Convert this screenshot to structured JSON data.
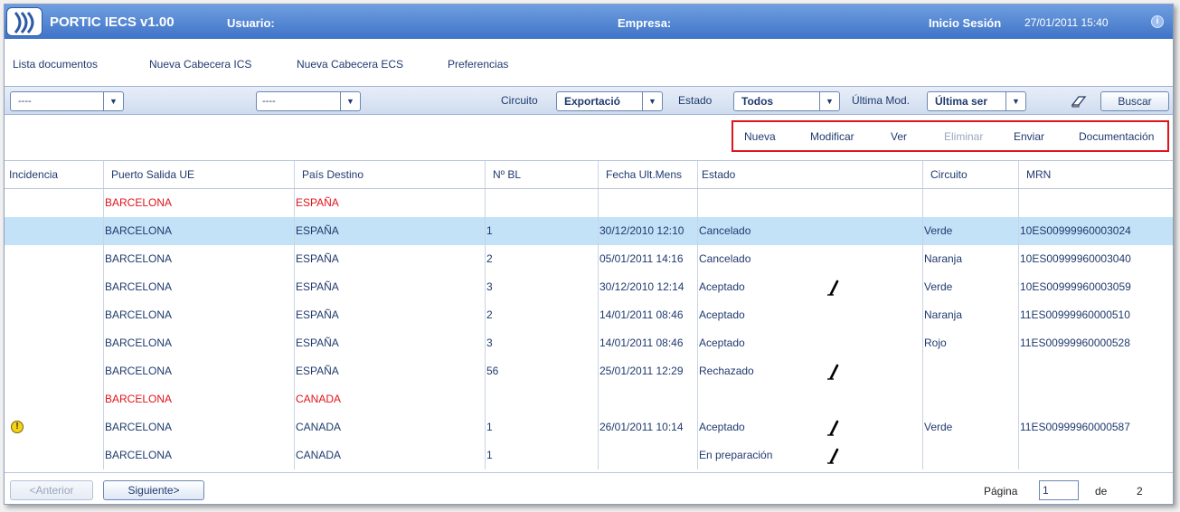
{
  "header": {
    "app_title": "PORTIC IECS v1.00",
    "usuario_label": "Usuario:",
    "empresa_label": "Empresa:",
    "inicio_label": "Inicio Sesión",
    "datetime": "27/01/2011 15:40",
    "info_glyph": "i"
  },
  "menu": {
    "items": [
      {
        "label": "Lista documentos"
      },
      {
        "label": "Nueva Cabecera ICS"
      },
      {
        "label": "Nueva Cabecera ECS"
      },
      {
        "label": "Preferencias"
      }
    ]
  },
  "filters": {
    "combo1_value": "----",
    "combo2_value": "----",
    "circuito_label": "Circuito",
    "circuito_value": "Exportació",
    "estado_label": "Estado",
    "estado_value": "Todos",
    "ultima_mod_label": "Última Mod.",
    "ultima_mod_value": "Última ser",
    "arrow_glyph": "▼",
    "buscar_label": "Buscar"
  },
  "actions": {
    "nueva": "Nueva",
    "modificar": "Modificar",
    "ver": "Ver",
    "eliminar": "Eliminar",
    "enviar": "Enviar",
    "documentacion": "Documentación"
  },
  "table": {
    "columns": [
      "Incidencia",
      "Puerto Salida UE",
      "País Destino",
      "Nº BL",
      "Fecha Ult.Mens",
      "Estado",
      "Circuito",
      "MRN"
    ],
    "rows": [
      {
        "incidencia": "",
        "puerto": "BARCELONA",
        "pais": "ESPAÑA",
        "bl": "",
        "fecha": "",
        "estado": "",
        "circuito": "",
        "mrn": "",
        "group": true,
        "selected": false,
        "edit": false,
        "warning": false
      },
      {
        "incidencia": "",
        "puerto": "BARCELONA",
        "pais": "ESPAÑA",
        "bl": "1",
        "fecha": "30/12/2010 12:10",
        "estado": "Cancelado",
        "circuito": "Verde",
        "mrn": "10ES00999960003024",
        "group": false,
        "selected": true,
        "edit": false,
        "warning": false
      },
      {
        "incidencia": "",
        "puerto": "BARCELONA",
        "pais": "ESPAÑA",
        "bl": "2",
        "fecha": "05/01/2011 14:16",
        "estado": "Cancelado",
        "circuito": "Naranja",
        "mrn": "10ES00999960003040",
        "group": false,
        "selected": false,
        "edit": false,
        "warning": false
      },
      {
        "incidencia": "",
        "puerto": "BARCELONA",
        "pais": "ESPAÑA",
        "bl": "3",
        "fecha": "30/12/2010 12:14",
        "estado": "Aceptado",
        "circuito": "Verde",
        "mrn": "10ES00999960003059",
        "group": false,
        "selected": false,
        "edit": true,
        "warning": false
      },
      {
        "incidencia": "",
        "puerto": "BARCELONA",
        "pais": "ESPAÑA",
        "bl": "2",
        "fecha": "14/01/2011 08:46",
        "estado": "Aceptado",
        "circuito": "Naranja",
        "mrn": "11ES00999960000510",
        "group": false,
        "selected": false,
        "edit": false,
        "warning": false
      },
      {
        "incidencia": "",
        "puerto": "BARCELONA",
        "pais": "ESPAÑA",
        "bl": "3",
        "fecha": "14/01/2011 08:46",
        "estado": "Aceptado",
        "circuito": "Rojo",
        "mrn": "11ES00999960000528",
        "group": false,
        "selected": false,
        "edit": false,
        "warning": false
      },
      {
        "incidencia": "",
        "puerto": "BARCELONA",
        "pais": "ESPAÑA",
        "bl": "56",
        "fecha": "25/01/2011 12:29",
        "estado": "Rechazado",
        "circuito": "",
        "mrn": "",
        "group": false,
        "selected": false,
        "edit": true,
        "warning": false
      },
      {
        "incidencia": "",
        "puerto": "BARCELONA",
        "pais": "CANADA",
        "bl": "",
        "fecha": "",
        "estado": "",
        "circuito": "",
        "mrn": "",
        "group": true,
        "selected": false,
        "edit": false,
        "warning": false
      },
      {
        "incidencia": "",
        "puerto": "BARCELONA",
        "pais": "CANADA",
        "bl": "1",
        "fecha": "26/01/2011 10:14",
        "estado": "Aceptado",
        "circuito": "Verde",
        "mrn": "11ES00999960000587",
        "group": false,
        "selected": false,
        "edit": true,
        "warning": true
      },
      {
        "incidencia": "",
        "puerto": "BARCELONA",
        "pais": "CANADA",
        "bl": "1",
        "fecha": "",
        "estado": "En preparación",
        "circuito": "",
        "mrn": "",
        "group": false,
        "selected": false,
        "edit": true,
        "warning": false
      }
    ]
  },
  "footer": {
    "anterior_label": "<Anterior",
    "siguiente_label": "Siguiente>",
    "pagina_label": "Página",
    "page_value": "1",
    "de_label": "de",
    "total_pages": "2"
  },
  "colors": {
    "header_blue": "#3f73c7",
    "selected_row": "#c3e2f7",
    "group_red": "#e0141c",
    "highlight_border": "#e0141c"
  }
}
